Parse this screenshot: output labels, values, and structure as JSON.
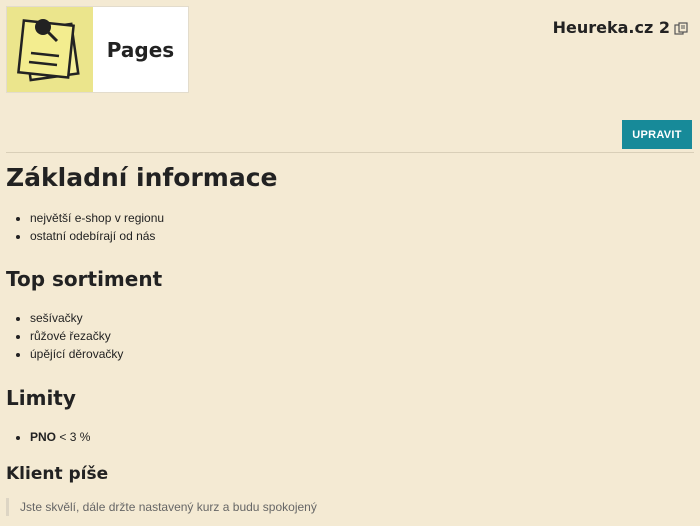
{
  "app": {
    "logo_label": "Pages",
    "page_name": "Heureka.cz 2"
  },
  "toolbar": {
    "edit_label": "UPRAVIT"
  },
  "content": {
    "section_basic": {
      "title": "Základní informace",
      "items": [
        "největší e-shop v regionu",
        "ostatní odebírají od nás"
      ]
    },
    "section_top": {
      "title": "Top sortiment",
      "items": [
        "sešívačky",
        "růžové řezačky",
        "úpějící děrovačky"
      ]
    },
    "section_limits": {
      "title": "Limity",
      "items": [
        {
          "strong": "PNO",
          "rest": " < 3 %"
        }
      ]
    },
    "section_client": {
      "title": "Klient píše",
      "quote": "Jste skvělí, dále držte nastavený kurz a budu spokojený"
    }
  },
  "colors": {
    "background": "#f4ead3",
    "accent_button": "#178a99",
    "logo_note": "#ebe58c"
  },
  "icons": {
    "logo": "sticky-note-pin-icon",
    "page_action": "copy-page-icon"
  }
}
